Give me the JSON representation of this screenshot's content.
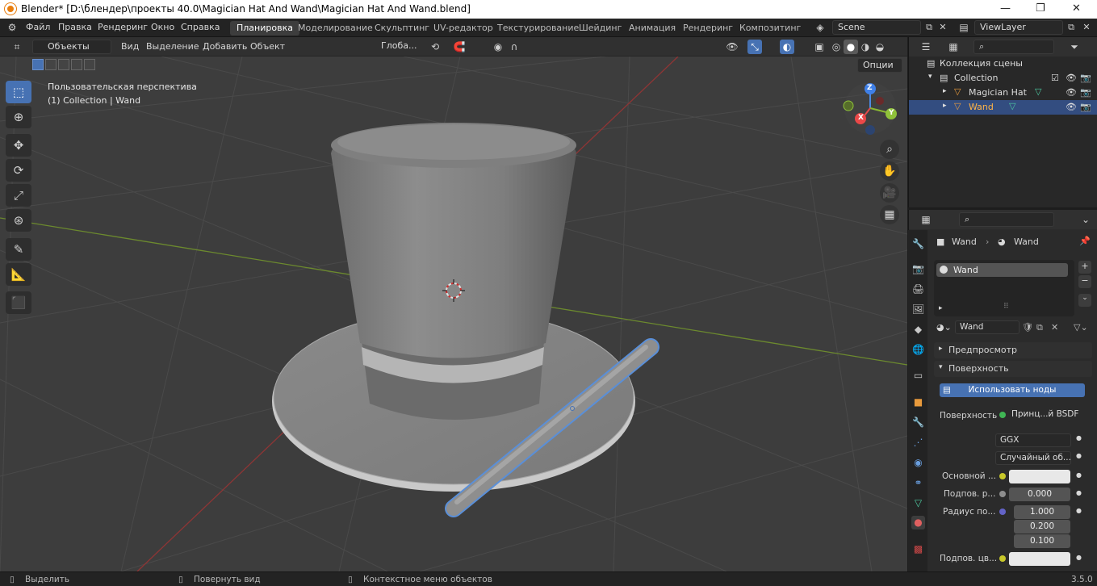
{
  "window": {
    "title": "Blender* [D:\\блендер\\проекты 40.0\\Magician Hat And Wand\\Magician Hat And Wand.blend]",
    "controls": [
      "—",
      "❐",
      "✕"
    ]
  },
  "topbar": {
    "menus": [
      "Файл",
      "Правка",
      "Рендеринг",
      "Окно",
      "Справка"
    ],
    "workspaces": [
      "Планировка",
      "Моделирование",
      "Скульптинг",
      "UV-редактор",
      "Текстурирование",
      "Шейдинг",
      "Анимация",
      "Рендеринг",
      "Композитинг"
    ],
    "active_workspace": "Планировка",
    "scene": "Scene",
    "view_layer": "ViewLayer"
  },
  "viewport_header": {
    "mode": "Объекты",
    "menus": [
      "Вид",
      "Выделение",
      "Добавить",
      "Объект"
    ],
    "orientation": "Глоба...",
    "options_label": "Опции"
  },
  "viewport": {
    "info_line1": "Пользовательская перспектива",
    "info_line2": "(1) Collection | Wand",
    "gizmo": {
      "z": "Z",
      "y": "Y",
      "x": "X"
    },
    "tools": [
      "select-box",
      "cursor",
      "move",
      "rotate",
      "scale",
      "transform",
      "annotate",
      "measure",
      "add-cube"
    ]
  },
  "outliner": {
    "root": "Коллекция сцены",
    "collection": "Collection",
    "items": [
      {
        "name": "Magician Hat",
        "selected": false
      },
      {
        "name": "Wand",
        "selected": true
      }
    ]
  },
  "properties": {
    "breadcrumb_object": "Wand",
    "breadcrumb_material": "Wand",
    "material_slot": "Wand",
    "material_name": "Wand",
    "panels": {
      "preview": "Предпросмотр",
      "surface": "Поверхность"
    },
    "use_nodes": "Использовать ноды",
    "surface_label": "Поверхность",
    "surface_shader": "Принц...й BSDF",
    "distribution": "GGX",
    "subsurface_method": "Случайный об...",
    "base_color_label": "Основной ...",
    "subsurface_label": "Подпов. р...",
    "subsurface_value": "0.000",
    "radius_label": "Радиус по...",
    "radius_values": [
      "1.000",
      "0.200",
      "0.100"
    ],
    "subsurface_color_label": "Подпов. цв...",
    "colors": {
      "accent": "#4772b3",
      "selection": "#334d80",
      "yellow_socket": "#c7c729",
      "purple_socket": "#6363c7"
    }
  },
  "statusbar": {
    "select": "Выделить",
    "rotate": "Повернуть вид",
    "context": "Контекстное меню объектов",
    "version": "3.5.0"
  }
}
